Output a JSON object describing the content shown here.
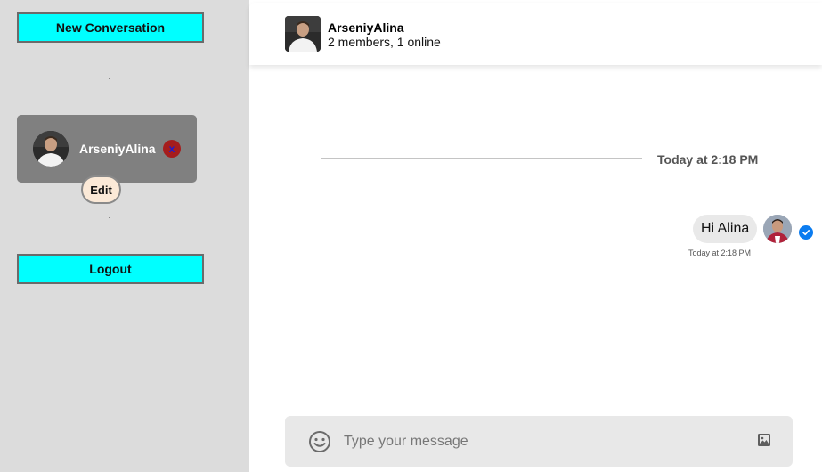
{
  "sidebar": {
    "new_conversation_label": "New Conversation",
    "logout_label": "Logout",
    "conversation": {
      "name": "ArseniyAlina",
      "delete_label": "x",
      "edit_label": "Edit"
    }
  },
  "chat": {
    "header": {
      "title": "ArseniyAlina",
      "subtitle": "2 members, 1 online"
    },
    "date_divider": "Today at 2:18 PM",
    "messages": [
      {
        "text": "Hi Alina",
        "time": "Today at 2:18 PM",
        "status": "read"
      }
    ],
    "composer": {
      "placeholder": "Type your message",
      "value": ""
    }
  },
  "icons": {
    "emoji": "smiley-icon",
    "image": "image-icon",
    "read_receipt": "check-circle-icon"
  },
  "colors": {
    "accent_button": "#00ffff",
    "sidebar_bg": "#dcdcdc",
    "card_bg": "#808080",
    "delete_bg": "#a51d1d",
    "check": "#0b7cf0"
  }
}
